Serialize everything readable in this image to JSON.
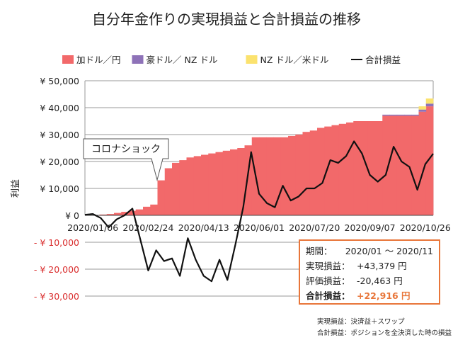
{
  "chart_data": {
    "type": "area",
    "title": "自分年金作りの実現損益と合計損益の推移",
    "ylabel": "利益",
    "ylim": [
      -30000,
      50000
    ],
    "yticks": [
      {
        "value": 50000,
        "label": "¥ 50,000"
      },
      {
        "value": 40000,
        "label": "¥ 40,000"
      },
      {
        "value": 30000,
        "label": "¥ 30,000"
      },
      {
        "value": 20000,
        "label": "¥ 20,000"
      },
      {
        "value": 10000,
        "label": "¥ 10,000"
      },
      {
        "value": 0,
        "label": "¥ 0"
      },
      {
        "value": -10000,
        "label": "- ¥ 10,000"
      },
      {
        "value": -20000,
        "label": "- ¥ 20,000"
      },
      {
        "value": -30000,
        "label": "- ¥ 30,000"
      }
    ],
    "xtick_labels": [
      "2020/01/06",
      "2020/02/24",
      "2020/04/13",
      "2020/06/01",
      "2020/07/20",
      "2020/09/07",
      "2020/10/26"
    ],
    "xtick_index": [
      1,
      8,
      15,
      22,
      29,
      36,
      43
    ],
    "grid": true,
    "legend_position": "top",
    "series": [
      {
        "name": "加ドル／円",
        "kind": "stacked-area",
        "color": "#f2696a",
        "values": [
          0,
          0,
          300,
          500,
          900,
          1300,
          1700,
          2200,
          3200,
          4000,
          13000,
          17500,
          19500,
          20500,
          21500,
          22000,
          22500,
          23000,
          23500,
          24000,
          24500,
          25000,
          26000,
          29000,
          29000,
          29000,
          29000,
          29000,
          29500,
          30000,
          31000,
          31500,
          32500,
          33000,
          33500,
          34000,
          34500,
          35000,
          35000,
          35000,
          35000,
          37000,
          37000,
          37000,
          37000,
          37000,
          38500,
          40500
        ]
      },
      {
        "name": "豪ドル／ NZ ドル",
        "kind": "stacked-area",
        "color": "#8e72b8",
        "values": [
          0,
          0,
          0,
          0,
          0,
          0,
          0,
          0,
          0,
          0,
          0,
          0,
          0,
          0,
          0,
          0,
          0,
          0,
          0,
          0,
          0,
          0,
          0,
          0,
          0,
          0,
          0,
          0,
          0,
          0,
          0,
          0,
          0,
          0,
          0,
          0,
          0,
          0,
          0,
          0,
          0,
          400,
          400,
          400,
          400,
          400,
          800,
          1000
        ]
      },
      {
        "name": "NZ ドル／米ドル",
        "kind": "stacked-area",
        "color": "#fbe26e",
        "values": [
          0,
          0,
          0,
          0,
          0,
          0,
          0,
          0,
          0,
          0,
          0,
          0,
          0,
          0,
          0,
          0,
          0,
          0,
          0,
          0,
          0,
          0,
          0,
          0,
          0,
          0,
          0,
          0,
          0,
          0,
          0,
          0,
          0,
          0,
          0,
          0,
          0,
          0,
          0,
          0,
          0,
          0,
          0,
          0,
          0,
          0,
          1200,
          1900
        ]
      },
      {
        "name": "合計損益",
        "kind": "line",
        "color": "#111111",
        "values": [
          200,
          500,
          -1000,
          -4500,
          -1500,
          0,
          2500,
          -9000,
          -20500,
          -13000,
          -17000,
          -16000,
          -22500,
          -8500,
          -16500,
          -22500,
          -24500,
          -16500,
          -24000,
          -11000,
          3000,
          23500,
          8000,
          4500,
          3000,
          11000,
          5500,
          7000,
          10000,
          10000,
          12000,
          20500,
          19500,
          22000,
          27500,
          23000,
          15000,
          12500,
          15000,
          25500,
          20000,
          18000,
          9500,
          19000,
          22900
        ]
      }
    ],
    "annotation": "コロナショック"
  },
  "info_box": {
    "rows": [
      {
        "label": "期間：",
        "value": "2020/01 ～ 2020/11"
      },
      {
        "label": "実現損益：",
        "value": "+43,379 円"
      },
      {
        "label": "評価損益：",
        "value": "-20,463 円"
      },
      {
        "label": "合計損益：",
        "value": "+22,916 円"
      }
    ]
  },
  "footnotes": [
    "実現損益：決済益＋スワップ",
    "合計損益：ポジションを全決済した時の損益"
  ],
  "colors": {
    "negative_tick": "#d92c2c",
    "accent": "#e8763a",
    "grid": "#9a9a9a"
  }
}
